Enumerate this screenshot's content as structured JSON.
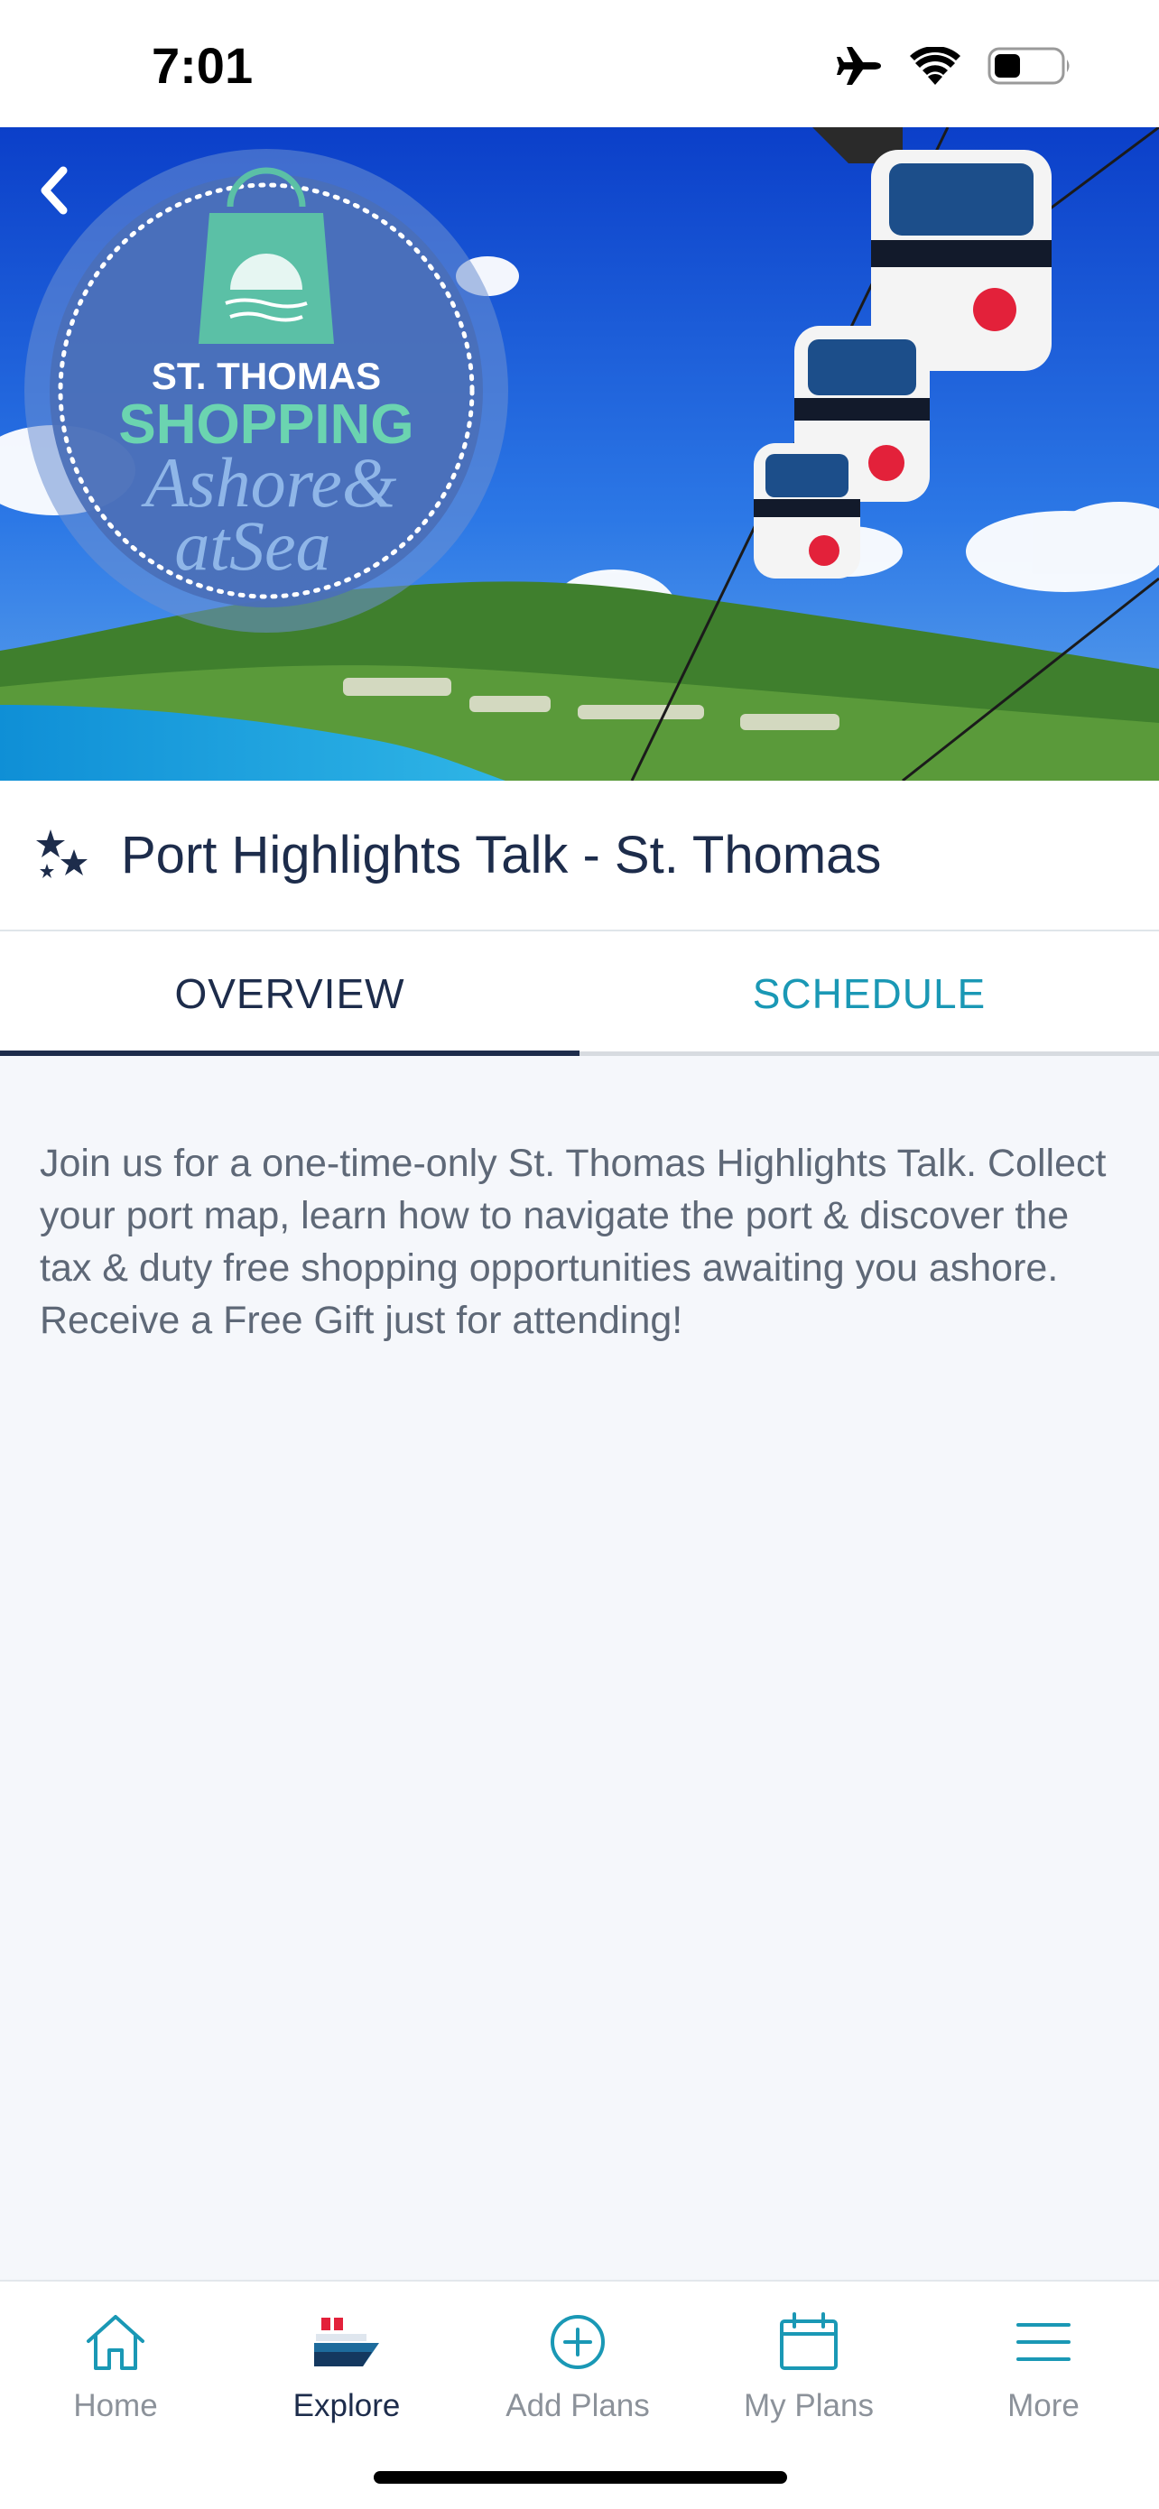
{
  "status": {
    "time": "7:01",
    "icons": [
      "airplane-icon",
      "wifi-icon",
      "battery-icon"
    ]
  },
  "hero": {
    "logo_line1": "ST. THOMAS",
    "logo_line2": "SHOPPING",
    "logo_line3": "Ashore&",
    "logo_line4": "atSea"
  },
  "event": {
    "title": "Port Highlights Talk - St. Thomas",
    "icon": "stars-icon"
  },
  "tabs": [
    {
      "label": "OVERVIEW",
      "active": true
    },
    {
      "label": "SCHEDULE",
      "active": false
    }
  ],
  "overview": {
    "description": "Join us for a one-time-only St. Thomas Highlights Talk. Collect your port map, learn how to navigate the port & discover the tax & duty free shopping opportunities awaiting you ashore. Receive a Free Gift just for attending!"
  },
  "nav": {
    "items": [
      {
        "label": "Home",
        "icon": "home-icon"
      },
      {
        "label": "Explore",
        "icon": "ship-icon",
        "active": true
      },
      {
        "label": "Add Plans",
        "icon": "plus-circle-icon"
      },
      {
        "label": "My Plans",
        "icon": "calendar-icon"
      },
      {
        "label": "More",
        "icon": "menu-icon"
      }
    ]
  },
  "colors": {
    "navy": "#1d2c4b",
    "teal": "#1a98b5",
    "background": "#f5f7fb"
  }
}
